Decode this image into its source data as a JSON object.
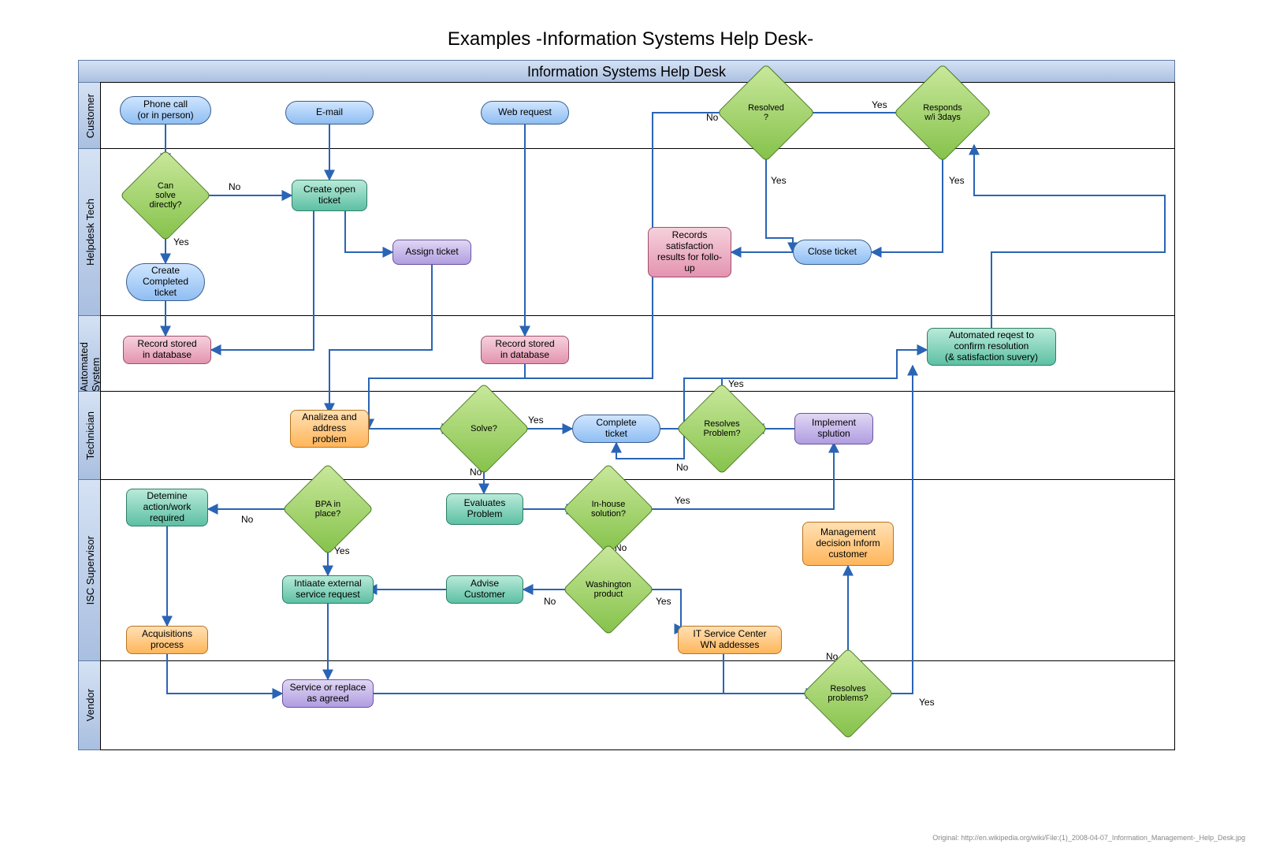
{
  "chart_data": {
    "type": "swimlane_flowchart",
    "title": "Examples -Information Systems Help Desk-",
    "pool": "Information Systems Help Desk",
    "lanes": [
      "Customer",
      "Helpdesk Tech",
      "Automated System",
      "Technician",
      "ISC Supervisor",
      "Vendor"
    ],
    "nodes": [
      {
        "id": "phone",
        "lane": "Customer",
        "type": "terminator",
        "label": "Phone call\n(or in person)"
      },
      {
        "id": "email",
        "lane": "Customer",
        "type": "terminator",
        "label": "E-mail"
      },
      {
        "id": "web",
        "lane": "Customer",
        "type": "terminator",
        "label": "Web request"
      },
      {
        "id": "resolved",
        "lane": "Customer",
        "type": "decision",
        "label": "Resolved\n?"
      },
      {
        "id": "responds",
        "lane": "Customer",
        "type": "decision",
        "label": "Responds\nw/i 3days"
      },
      {
        "id": "cansolve",
        "lane": "Helpdesk Tech",
        "type": "decision",
        "label": "Can\nsolve\ndirectly?"
      },
      {
        "id": "openticket",
        "lane": "Helpdesk Tech",
        "type": "process",
        "style": "teal",
        "label": "Create open\nticket"
      },
      {
        "id": "assign",
        "lane": "Helpdesk Tech",
        "type": "process",
        "style": "purple",
        "label": "Assign ticket"
      },
      {
        "id": "completed",
        "lane": "Helpdesk Tech",
        "type": "terminator",
        "label": "Create\nCompleted\nticket"
      },
      {
        "id": "closeticket",
        "lane": "Helpdesk Tech",
        "type": "terminator",
        "label": "Close ticket"
      },
      {
        "id": "satisfaction",
        "lane": "Helpdesk Tech",
        "type": "process",
        "style": "pink",
        "label": "Records\nsatisfaction\nresults for follo-\nup"
      },
      {
        "id": "record1",
        "lane": "Automated System",
        "type": "process",
        "style": "pink",
        "label": "Record stored\nin database"
      },
      {
        "id": "record2",
        "lane": "Automated System",
        "type": "process",
        "style": "pink",
        "label": "Record stored\nin database"
      },
      {
        "id": "autoreq",
        "lane": "Automated System",
        "type": "process",
        "style": "teal",
        "label": "Automated reqest to\nconfirm resolution\n(& satisfaction suvery)"
      },
      {
        "id": "analyze",
        "lane": "Technician",
        "type": "process",
        "style": "orange",
        "label": "Analizea and\naddress\nproblem"
      },
      {
        "id": "solve",
        "lane": "Technician",
        "type": "decision",
        "label": "Solve?"
      },
      {
        "id": "completetkt",
        "lane": "Technician",
        "type": "terminator",
        "label": "Complete\nticket"
      },
      {
        "id": "resolvesprob",
        "lane": "Technician",
        "type": "decision",
        "label": "Resolves\nProblem?"
      },
      {
        "id": "implement",
        "lane": "Technician",
        "type": "process",
        "style": "purple",
        "label": "Implement\nsplution"
      },
      {
        "id": "determine",
        "lane": "ISC Supervisor",
        "type": "process",
        "style": "teal",
        "label": "Detemine\naction/work\nrequired"
      },
      {
        "id": "bpa",
        "lane": "ISC Supervisor",
        "type": "decision",
        "label": "BPA in\nplace?"
      },
      {
        "id": "evaluates",
        "lane": "ISC Supervisor",
        "type": "process",
        "style": "teal",
        "label": "Evaluates\nProblem"
      },
      {
        "id": "inhouse",
        "lane": "ISC Supervisor",
        "type": "decision",
        "label": "In-house\nsolution?"
      },
      {
        "id": "initiate",
        "lane": "ISC Supervisor",
        "type": "process",
        "style": "teal",
        "label": "Intiaate external\nservice request"
      },
      {
        "id": "advise",
        "lane": "ISC Supervisor",
        "type": "process",
        "style": "teal",
        "label": "Advise\nCustomer"
      },
      {
        "id": "washington",
        "lane": "ISC Supervisor",
        "type": "decision",
        "label": "Washington\nproduct"
      },
      {
        "id": "mgmt",
        "lane": "ISC Supervisor",
        "type": "process",
        "style": "orange",
        "label": "Management\ndecision Inform\ncustomer"
      },
      {
        "id": "itservice",
        "lane": "ISC Supervisor",
        "type": "process",
        "style": "orange",
        "label": "IT Service Center\nWN addesses"
      },
      {
        "id": "acquisitions",
        "lane": "Vendor",
        "type": "process",
        "style": "orange",
        "label": "Acquisitions\nprocess"
      },
      {
        "id": "service",
        "lane": "Vendor",
        "type": "process",
        "style": "purple",
        "label": "Service or replace\nas agreed"
      },
      {
        "id": "resolvesproblems",
        "lane": "Vendor",
        "type": "decision",
        "label": "Resolves\nproblems?"
      }
    ],
    "edges": [
      {
        "from": "phone",
        "to": "cansolve"
      },
      {
        "from": "email",
        "to": "openticket"
      },
      {
        "from": "cansolve",
        "to": "openticket",
        "label": "No"
      },
      {
        "from": "cansolve",
        "to": "completed",
        "label": "Yes"
      },
      {
        "from": "completed",
        "to": "record1"
      },
      {
        "from": "openticket",
        "to": "record1"
      },
      {
        "from": "openticket",
        "to": "assign"
      },
      {
        "from": "assign",
        "to": "analyze"
      },
      {
        "from": "web",
        "to": "record2"
      },
      {
        "from": "record2",
        "to": "analyze"
      },
      {
        "from": "analyze",
        "to": "solve"
      },
      {
        "from": "solve",
        "to": "completetkt",
        "label": "Yes"
      },
      {
        "from": "solve",
        "to": "evaluates",
        "label": "No"
      },
      {
        "from": "completetkt",
        "to": "autoreq"
      },
      {
        "from": "autoreq",
        "to": "responds"
      },
      {
        "from": "responds",
        "to": "resolved",
        "label": "Yes"
      },
      {
        "from": "responds",
        "to": "closeticket",
        "label": "Yes"
      },
      {
        "from": "resolved",
        "to": "closeticket",
        "label": "Yes"
      },
      {
        "from": "resolved",
        "to": "analyze",
        "label": "No"
      },
      {
        "from": "closeticket",
        "to": "satisfaction"
      },
      {
        "from": "evaluates",
        "to": "inhouse"
      },
      {
        "from": "inhouse",
        "to": "implement",
        "label": "Yes"
      },
      {
        "from": "inhouse",
        "to": "washington",
        "label": "No"
      },
      {
        "from": "implement",
        "to": "resolvesprob"
      },
      {
        "from": "resolvesprob",
        "to": "autoreq",
        "label": "Yes"
      },
      {
        "from": "resolvesprob",
        "to": "completetkt",
        "label": "No"
      },
      {
        "from": "washington",
        "to": "itservice",
        "label": "Yes"
      },
      {
        "from": "washington",
        "to": "advise",
        "label": "No"
      },
      {
        "from": "advise",
        "to": "initiate"
      },
      {
        "from": "bpa",
        "to": "determine",
        "label": "No"
      },
      {
        "from": "bpa",
        "to": "initiate",
        "label": "Yes"
      },
      {
        "from": "determine",
        "to": "acquisitions"
      },
      {
        "from": "acquisitions",
        "to": "service"
      },
      {
        "from": "initiate",
        "to": "service"
      },
      {
        "from": "itservice",
        "to": "resolvesproblems"
      },
      {
        "from": "service",
        "to": "resolvesproblems"
      },
      {
        "from": "resolvesproblems",
        "to": "autoreq",
        "label": "Yes"
      },
      {
        "from": "resolvesproblems",
        "to": "mgmt",
        "label": "No"
      }
    ]
  },
  "page_title": "Examples -Information Systems Help Desk-",
  "pool_title": "Information Systems Help Desk",
  "lanes": {
    "customer": "Customer",
    "helpdesk": "Helpdesk Tech",
    "auto": "Automated System",
    "tech": "Technician",
    "isc": "ISC Supervisor",
    "vendor": "Vendor"
  },
  "n": {
    "phone": "Phone call\n(or in person)",
    "email": "E-mail",
    "web": "Web request",
    "resolved": "Resolved\n?",
    "responds": "Responds\nw/i 3days",
    "cansolve": "Can\nsolve\ndirectly?",
    "openticket": "Create open\nticket",
    "assign": "Assign ticket",
    "completed": "Create\nCompleted\nticket",
    "closeticket": "Close ticket",
    "satisfaction": "Records\nsatisfaction\nresults for follo-\nup",
    "record1": "Record stored\nin database",
    "record2": "Record stored\nin database",
    "autoreq": "Automated reqest to\nconfirm resolution\n(& satisfaction suvery)",
    "analyze": "Analizea and\naddress\nproblem",
    "solve": "Solve?",
    "completetkt": "Complete\nticket",
    "resolvesprob": "Resolves\nProblem?",
    "implement": "Implement\nsplution",
    "determine": "Detemine\naction/work\nrequired",
    "bpa": "BPA in\nplace?",
    "evaluates": "Evaluates\nProblem",
    "inhouse": "In-house\nsolution?",
    "initiate": "Intiaate external\nservice request",
    "advise": "Advise\nCustomer",
    "washington": "Washington\nproduct",
    "mgmt": "Management\ndecision Inform\ncustomer",
    "itservice": "IT Service Center\nWN addesses",
    "acquisitions": "Acquisitions\nprocess",
    "service": "Service or replace\nas agreed",
    "resolvesproblems": "Resolves\nproblems?"
  },
  "labels": {
    "yes": "Yes",
    "no": "No"
  },
  "credit": "Original: http://en.wikipedia.org/wiki/File:(1)_2008-04-07_Information_Management-_Help_Desk.jpg"
}
